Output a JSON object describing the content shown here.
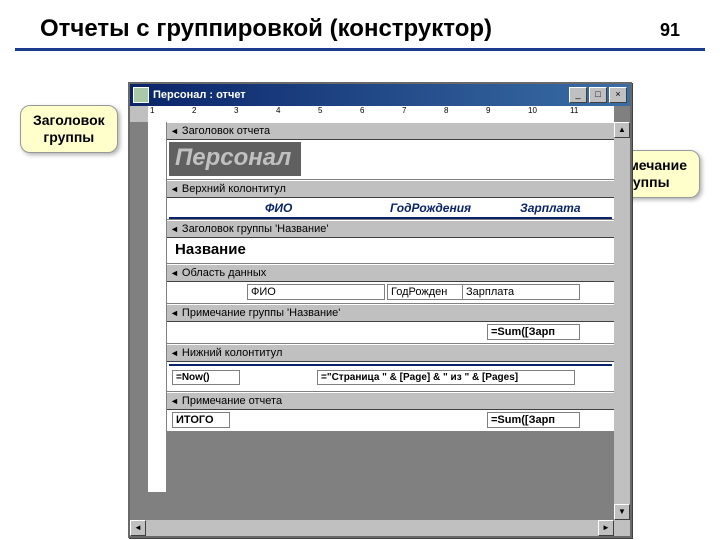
{
  "slide": {
    "title": "Отчеты с группировкой (конструктор)",
    "page_number": "91"
  },
  "callouts": {
    "group_header": "Заголовок\nгруппы",
    "group_footer": "Примечание\nгруппы"
  },
  "window": {
    "title": "Персонал : отчет",
    "ruler_marks": [
      "1",
      "2",
      "3",
      "4",
      "5",
      "6",
      "7",
      "8",
      "9",
      "10",
      "11"
    ]
  },
  "sections": {
    "report_header": {
      "label": "Заголовок отчета",
      "title_control": "Персонал"
    },
    "page_header": {
      "label": "Верхний колонтитул",
      "col1": "ФИО",
      "col2": "ГодРождения",
      "col3": "Зарплата"
    },
    "group_header": {
      "label": "Заголовок группы 'Название'",
      "field": "Название"
    },
    "detail": {
      "label": "Область данных",
      "f1": "ФИО",
      "f2": "ГодРожден",
      "f3": "Зарплата"
    },
    "group_footer": {
      "label": "Примечание группы 'Название'",
      "sum": "=Sum([Зарп"
    },
    "page_footer": {
      "label": "Нижний колонтитул",
      "now": "=Now()",
      "pages": "=\"Страница \" & [Page] & \" из \" & [Pages]"
    },
    "report_footer": {
      "label": "Примечание отчета",
      "total": "ИТОГО",
      "sum": "=Sum([Зарп"
    }
  }
}
